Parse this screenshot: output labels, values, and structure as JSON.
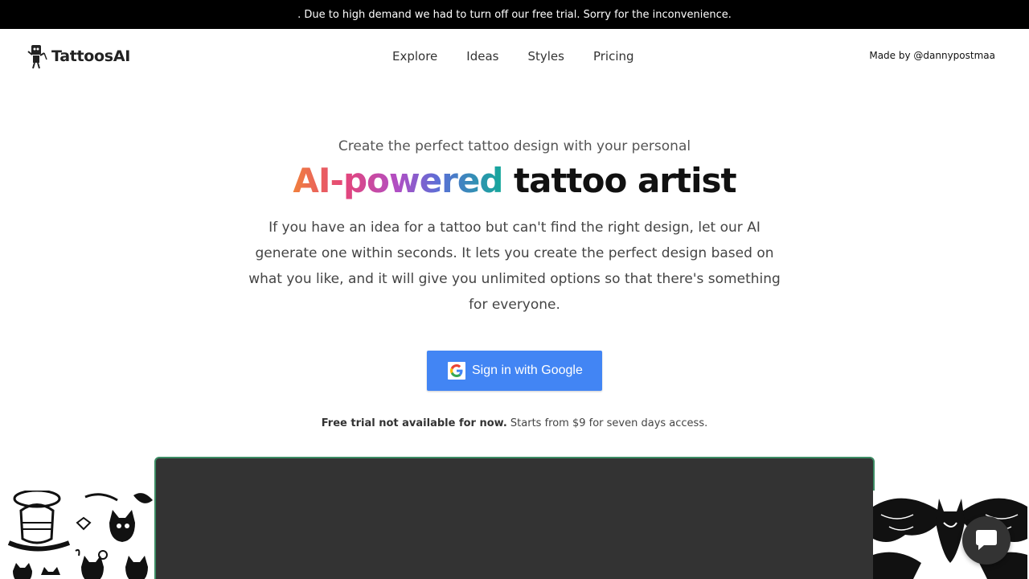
{
  "banner": {
    "text": ". Due to high demand we had to turn off our free trial. Sorry for the inconvenience."
  },
  "nav": {
    "logo_text": "TattoosAI",
    "links": [
      {
        "label": "Explore"
      },
      {
        "label": "Ideas"
      },
      {
        "label": "Styles"
      },
      {
        "label": "Pricing"
      }
    ],
    "made_by": "Made by @dannypostmaa"
  },
  "hero": {
    "subtitle": "Create the perfect tattoo design with your personal",
    "headline_gradient": "AI-powered",
    "headline_rest": " tattoo artist",
    "description": "If you have an idea for a tattoo but can't find the right design, let our AI generate one within seconds. It lets you create the perfect design based on what you like, and it will give you unlimited options so that there's something for everyone."
  },
  "signin": {
    "label": "Sign in with Google",
    "icon": "google-icon"
  },
  "trial": {
    "bold": "Free trial not available for now.",
    "rest": " Starts from $9 for seven days access."
  },
  "colors": {
    "banner_bg": "#000000",
    "google_blue": "#4285f4",
    "video_bg": "#333333",
    "video_border": "#3c8c64"
  },
  "chat": {
    "icon": "chat-bubble-icon"
  }
}
